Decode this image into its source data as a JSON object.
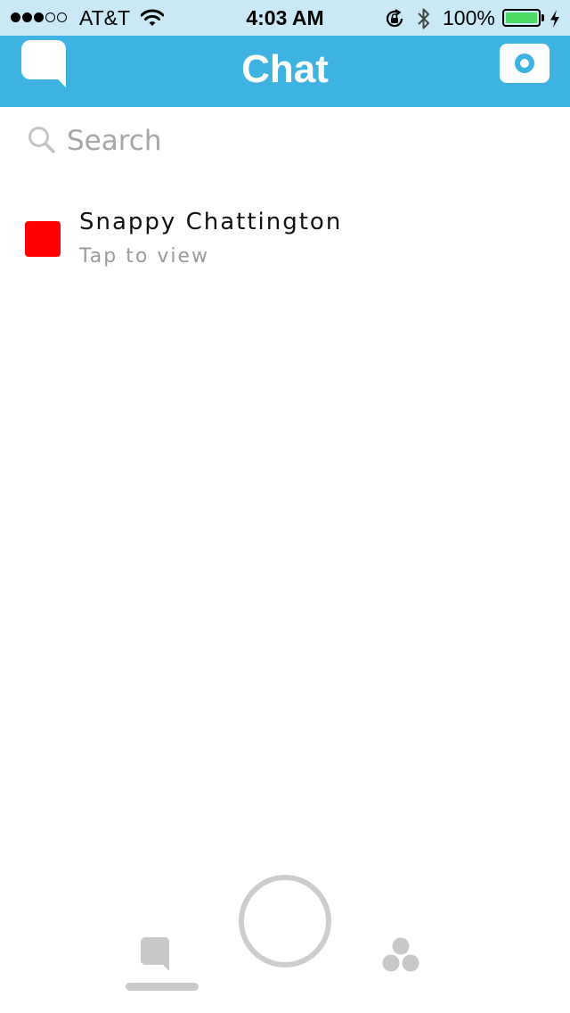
{
  "status_bar": {
    "carrier": "AT&T",
    "time": "4:03 AM",
    "battery_percent": "100%",
    "signal_bars_filled": 3,
    "signal_bars_total": 5,
    "battery_level": 1.0,
    "battery_color": "#4cd964"
  },
  "header": {
    "title": "Chat",
    "background_color": "#3eb2e1",
    "left_icon": "chat-bubble-icon",
    "right_icon": "camera-icon"
  },
  "search": {
    "placeholder": "Search",
    "value": ""
  },
  "chats": [
    {
      "name": "Snappy Chattington",
      "subtitle": "Tap to view",
      "status_color": "#ff0000"
    }
  ],
  "bottom_nav": {
    "items": [
      "chat-icon",
      "capture-button",
      "stories-icon"
    ],
    "active": "chat-icon"
  }
}
